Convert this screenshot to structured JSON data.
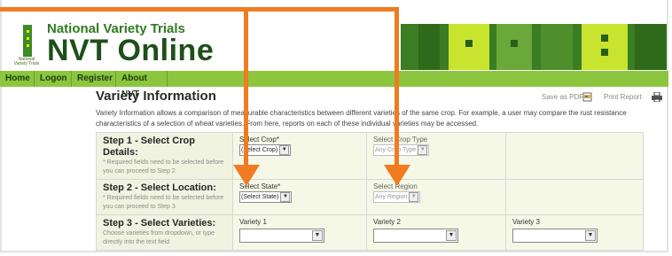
{
  "header": {
    "logo_small_text": "National Variety Trials",
    "brand_top": "National Variety Trials",
    "brand_main": "NVT Online"
  },
  "nav": [
    "Home",
    "Logon",
    "Register",
    "About NVT"
  ],
  "page": {
    "title": "Variety Information",
    "save_pdf": "Save as PDF",
    "print_report": "Print Report",
    "intro": "Variety Information allows a comparison of measurable characteristics between different varieties of the same crop. For example, a user may compare the rust resistance characteristics of a selection of wheat varieties. From here, reports on each of these individual varieties may be accessed."
  },
  "steps": [
    {
      "heading": "Step 1 - Select Crop Details:",
      "sub": "* Required fields need to be selected before you can proceed to Step 2",
      "field1_label": "Select Crop*",
      "field1_value": "(Select Crop)",
      "field2_label": "Select Crop Type",
      "field2_value": "Any Crop Type"
    },
    {
      "heading": "Step 2 - Select Location:",
      "sub": "* Required fields need to be selected before you can proceed to Step 3",
      "field1_label": "Select State*",
      "field1_value": "(Select State)",
      "field2_label": "Select Region",
      "field2_value": "Any Region"
    },
    {
      "heading": "Step 3 - Select Varieties:",
      "sub": "Choose varieties from dropdown, or type directly into the text field",
      "field1_label": "Variety 1",
      "field2_label": "Variety 2",
      "field3_label": "Variety 3"
    }
  ],
  "colors": {
    "nav": "#8cc63f",
    "brand": "#1f4f1a",
    "annotation_arrow": "#f07b21"
  }
}
